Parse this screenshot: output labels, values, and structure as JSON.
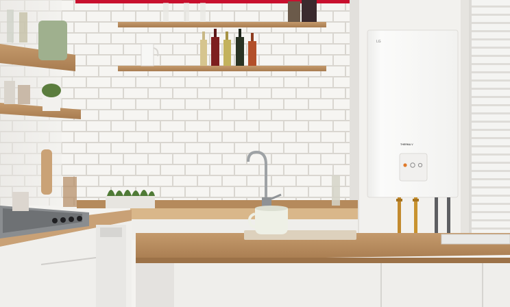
{
  "photo": {
    "subject": "kitchen-with-wall-mounted-boiler",
    "colors": {
      "accent_bar": "#c8102e",
      "tile": "#f3f2ef",
      "grout": "#d9d6d0",
      "wood": "#b58a5c",
      "boiler": "#f7f7f5",
      "cabinet": "#efeeeb",
      "mug": "#eef0e6",
      "herbs": "#4f7a36",
      "copper_pipe": "#c28a2e"
    }
  },
  "boiler": {
    "brand_logo": "LG",
    "model_text": "THERMA V",
    "controller_icons": [
      "power-icon",
      "temperature-icon",
      "mode-icon"
    ]
  }
}
